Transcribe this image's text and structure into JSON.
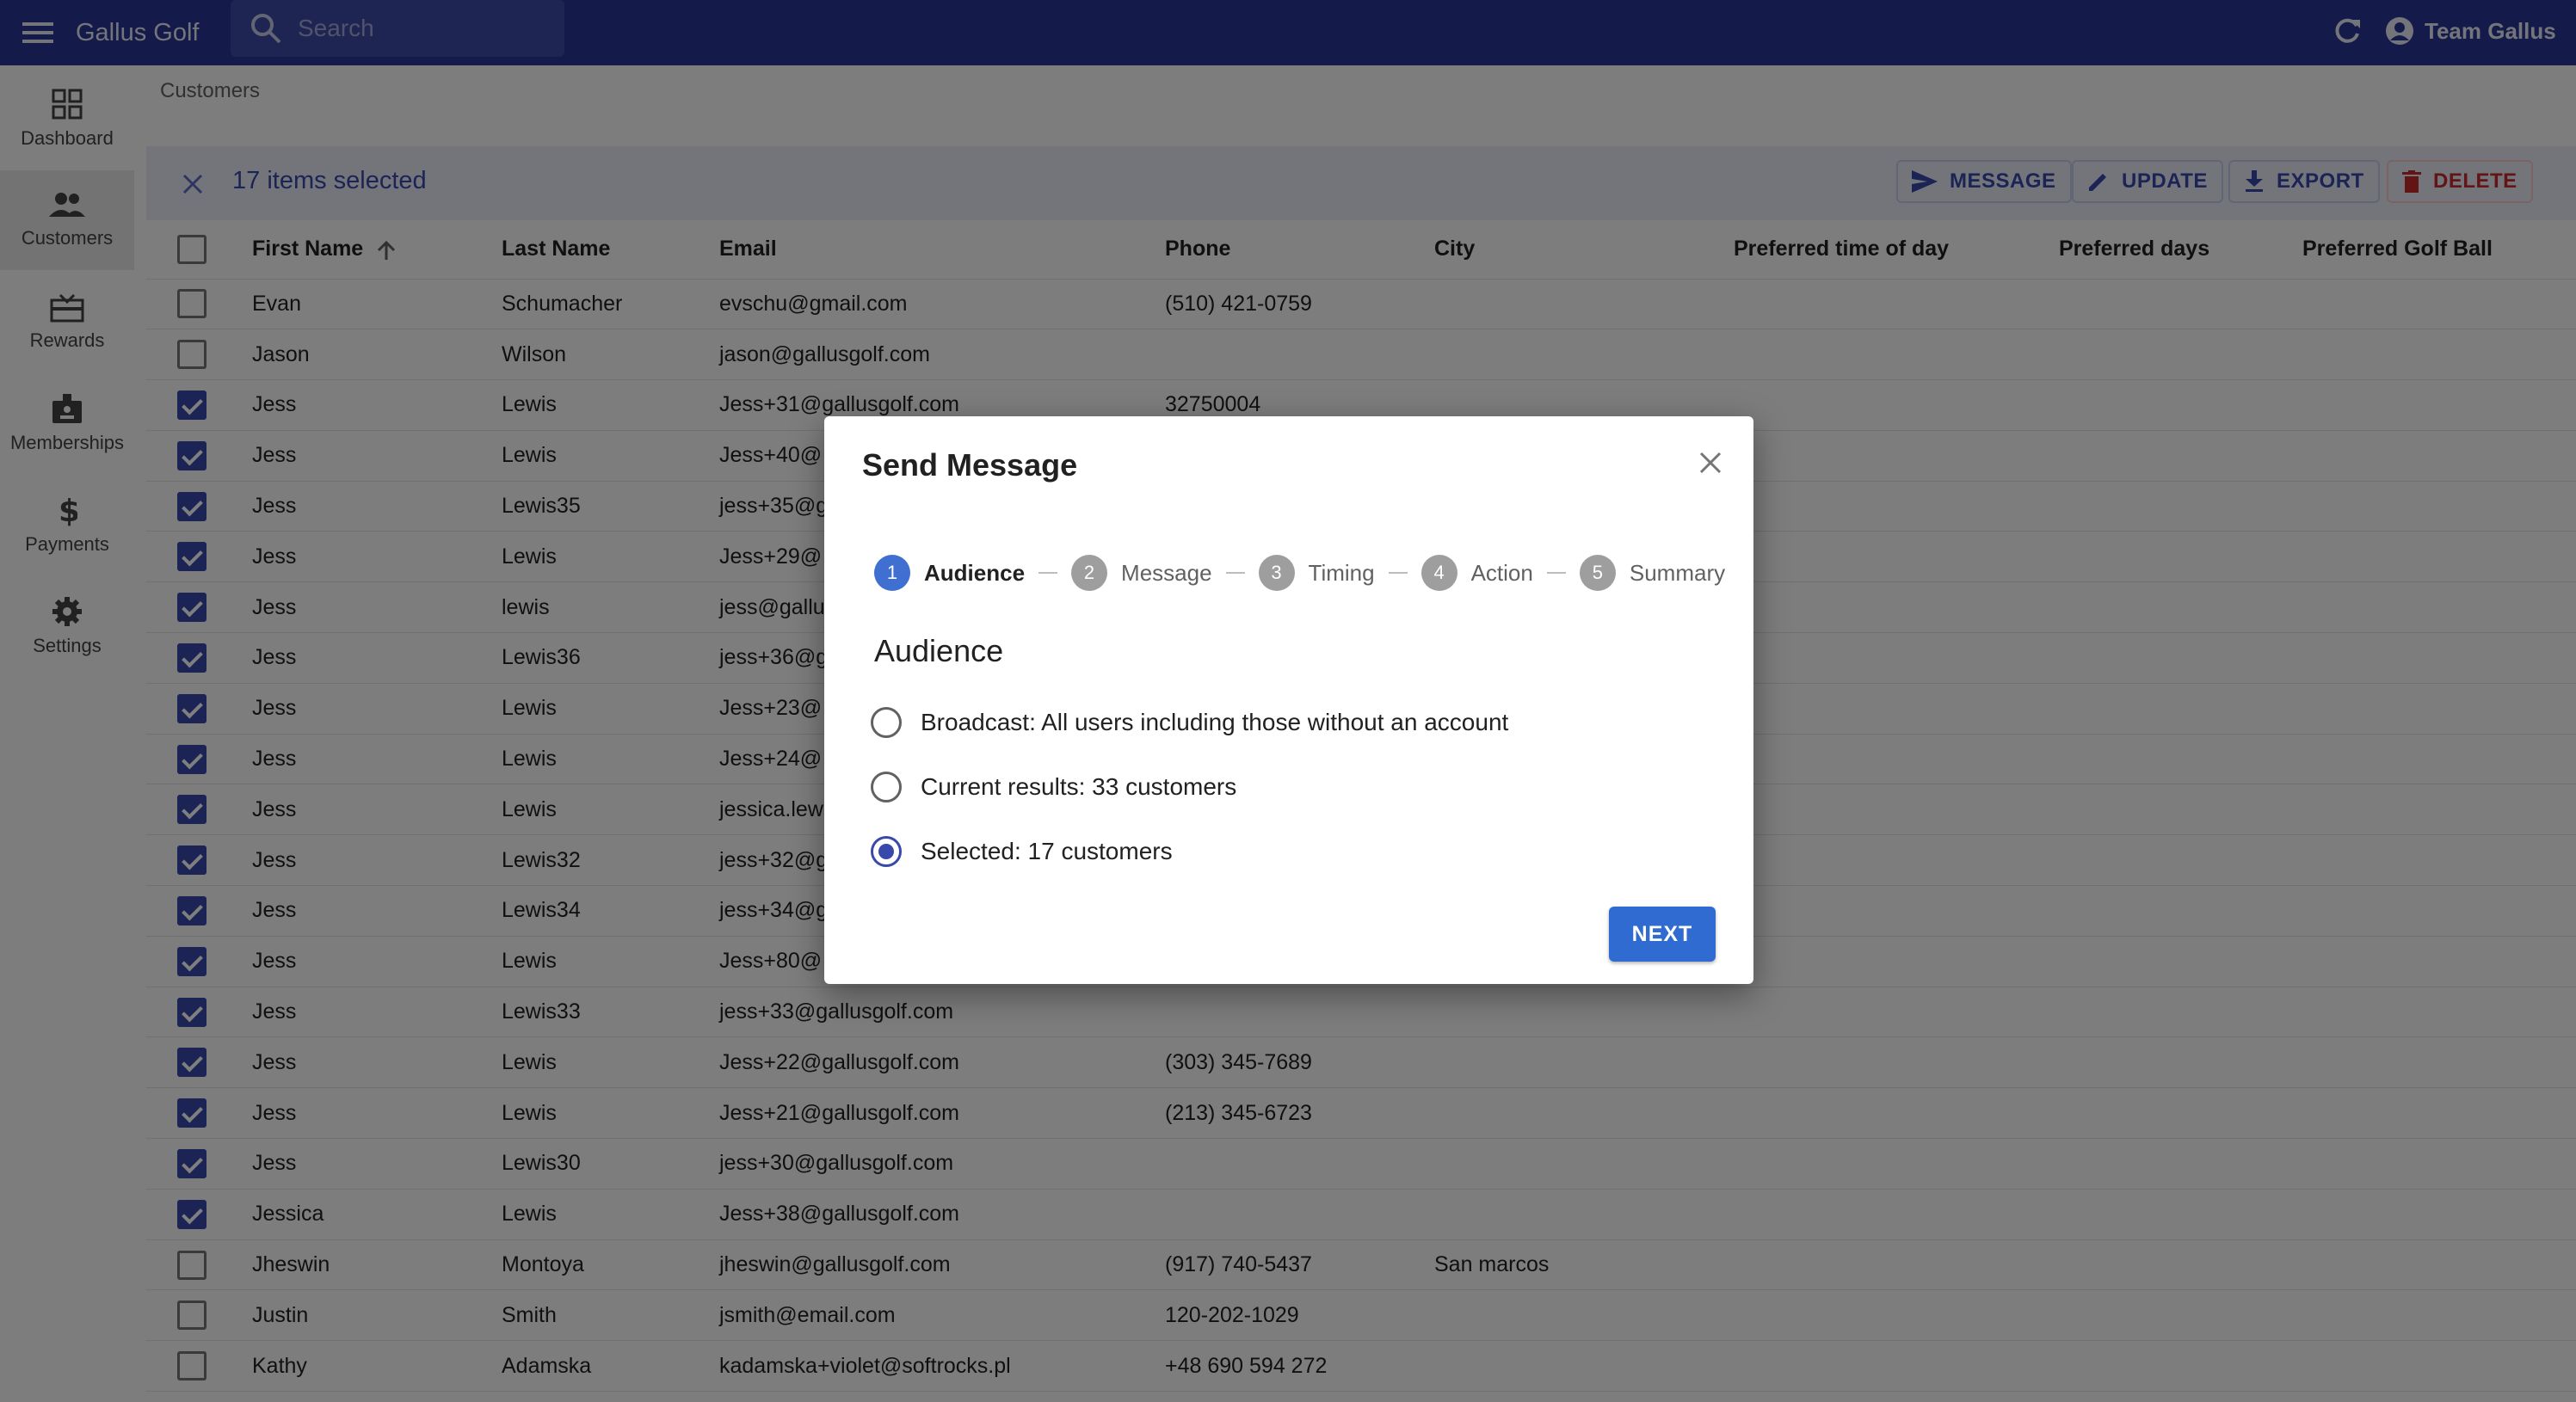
{
  "appbar": {
    "title": "Gallus Golf",
    "search_placeholder": "Search",
    "user_name": "Team Gallus"
  },
  "sidebar": {
    "items": [
      {
        "label": "Dashboard",
        "icon": "dashboard-icon"
      },
      {
        "label": "Customers",
        "icon": "people-icon",
        "active": true
      },
      {
        "label": "Rewards",
        "icon": "gift-card-icon"
      },
      {
        "label": "Memberships",
        "icon": "badge-icon"
      },
      {
        "label": "Payments",
        "icon": "dollar-icon"
      },
      {
        "label": "Settings",
        "icon": "gear-icon"
      }
    ]
  },
  "breadcrumb": "Customers",
  "bulk_bar": {
    "selected_text": "17 items selected",
    "actions": {
      "message": "MESSAGE",
      "update": "UPDATE",
      "export": "EXPORT",
      "delete": "DELETE"
    }
  },
  "table": {
    "columns": [
      "First Name",
      "Last Name",
      "Email",
      "Phone",
      "City",
      "Preferred time of day",
      "Preferred days",
      "Preferred Golf Ball"
    ],
    "rows": [
      {
        "checked": false,
        "first": "Evan",
        "last": "Schumacher",
        "email": "evschu@gmail.com",
        "phone": "(510) 421-0759",
        "city": ""
      },
      {
        "checked": false,
        "first": "Jason",
        "last": "Wilson",
        "email": "jason@gallusgolf.com",
        "phone": "",
        "city": ""
      },
      {
        "checked": true,
        "first": "Jess",
        "last": "Lewis",
        "email": "Jess+31@gallusgolf.com",
        "phone": "32750004",
        "city": ""
      },
      {
        "checked": true,
        "first": "Jess",
        "last": "Lewis",
        "email": "Jess+40@",
        "phone": "",
        "city": ""
      },
      {
        "checked": true,
        "first": "Jess",
        "last": "Lewis35",
        "email": "jess+35@g",
        "phone": "",
        "city": ""
      },
      {
        "checked": true,
        "first": "Jess",
        "last": "Lewis",
        "email": "Jess+29@",
        "phone": "",
        "city": ""
      },
      {
        "checked": true,
        "first": "Jess",
        "last": "lewis",
        "email": "jess@gallu",
        "phone": "",
        "city": ""
      },
      {
        "checked": true,
        "first": "Jess",
        "last": "Lewis36",
        "email": "jess+36@g",
        "phone": "",
        "city": ""
      },
      {
        "checked": true,
        "first": "Jess",
        "last": "Lewis",
        "email": "Jess+23@",
        "phone": "",
        "city": ""
      },
      {
        "checked": true,
        "first": "Jess",
        "last": "Lewis",
        "email": "Jess+24@",
        "phone": "",
        "city": ""
      },
      {
        "checked": true,
        "first": "Jess",
        "last": "Lewis",
        "email": "jessica.lew",
        "phone": "",
        "city": ""
      },
      {
        "checked": true,
        "first": "Jess",
        "last": "Lewis32",
        "email": "jess+32@g",
        "phone": "",
        "city": ""
      },
      {
        "checked": true,
        "first": "Jess",
        "last": "Lewis34",
        "email": "jess+34@g",
        "phone": "",
        "city": ""
      },
      {
        "checked": true,
        "first": "Jess",
        "last": "Lewis",
        "email": "Jess+80@",
        "phone": "",
        "city": ""
      },
      {
        "checked": true,
        "first": "Jess",
        "last": "Lewis33",
        "email": "jess+33@gallusgolf.com",
        "phone": "",
        "city": ""
      },
      {
        "checked": true,
        "first": "Jess",
        "last": "Lewis",
        "email": "Jess+22@gallusgolf.com",
        "phone": "(303) 345-7689",
        "city": ""
      },
      {
        "checked": true,
        "first": "Jess",
        "last": "Lewis",
        "email": "Jess+21@gallusgolf.com",
        "phone": "(213) 345-6723",
        "city": ""
      },
      {
        "checked": true,
        "first": "Jess",
        "last": "Lewis30",
        "email": "jess+30@gallusgolf.com",
        "phone": "",
        "city": ""
      },
      {
        "checked": true,
        "first": "Jessica",
        "last": "Lewis",
        "email": "Jess+38@gallusgolf.com",
        "phone": "",
        "city": ""
      },
      {
        "checked": false,
        "first": "Jheswin",
        "last": "Montoya",
        "email": "jheswin@gallusgolf.com",
        "phone": "(917) 740-5437",
        "city": "San marcos"
      },
      {
        "checked": false,
        "first": "Justin",
        "last": "Smith",
        "email": "jsmith@email.com",
        "phone": "120-202-1029",
        "city": ""
      },
      {
        "checked": false,
        "first": "Kathy",
        "last": "Adamska",
        "email": "kadamska+violet@softrocks.pl",
        "phone": "+48 690 594 272",
        "city": ""
      }
    ]
  },
  "dialog": {
    "title": "Send Message",
    "steps": [
      {
        "num": "1",
        "label": "Audience",
        "active": true
      },
      {
        "num": "2",
        "label": "Message"
      },
      {
        "num": "3",
        "label": "Timing"
      },
      {
        "num": "4",
        "label": "Action"
      },
      {
        "num": "5",
        "label": "Summary"
      }
    ],
    "section_title": "Audience",
    "options": [
      {
        "label": "Broadcast: All users including those without an account",
        "selected": false
      },
      {
        "label": "Current results: 33 customers",
        "selected": false
      },
      {
        "label": "Selected: 17 customers",
        "selected": true
      }
    ],
    "next_label": "NEXT"
  },
  "colors": {
    "appbar": "#283593",
    "accent": "#3949ab",
    "primary_button": "#2f6bd1",
    "danger": "#c62828"
  }
}
